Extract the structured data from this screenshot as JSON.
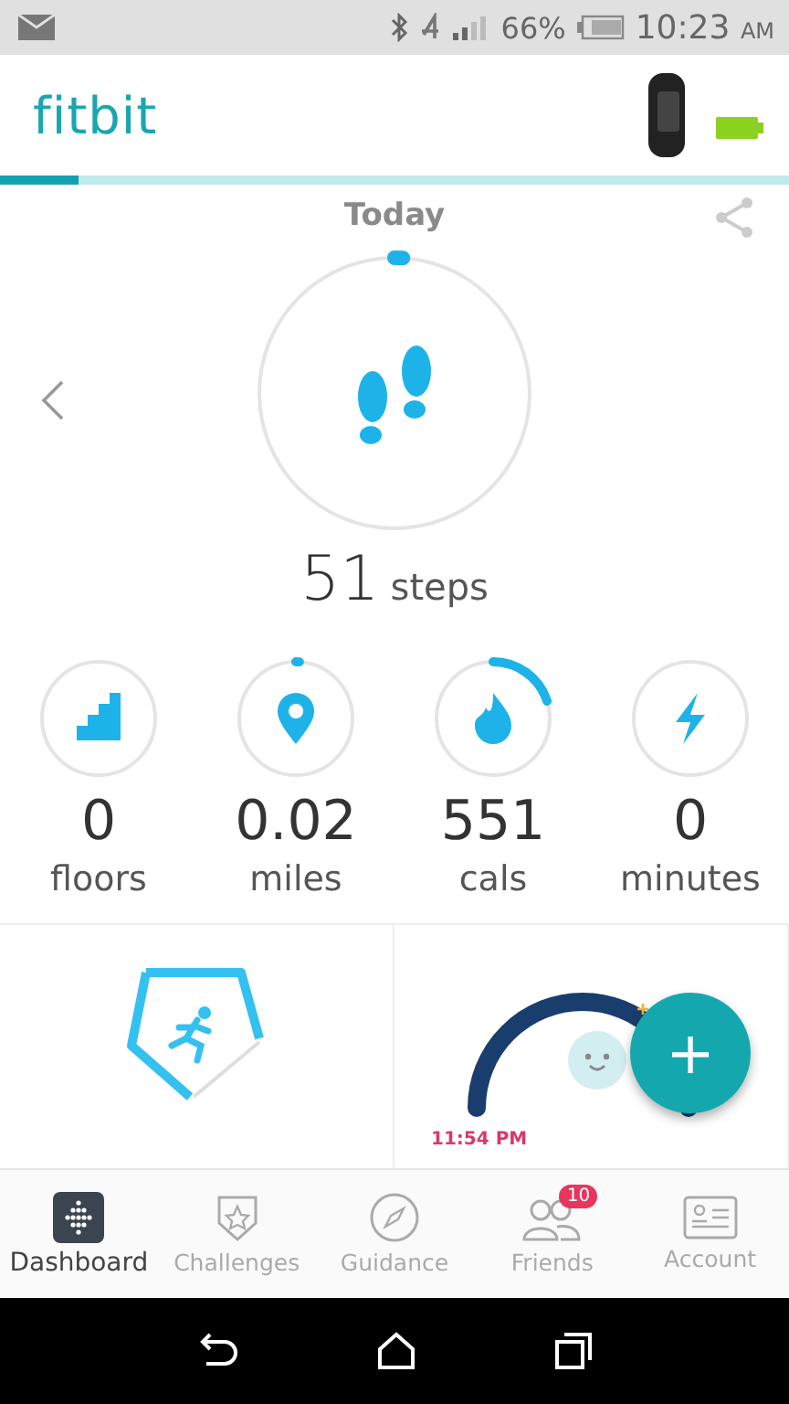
{
  "status_bar": {
    "battery": "66%",
    "time": "10:23",
    "ampm": "AM"
  },
  "header": {
    "logo": "fitbit",
    "level": 0.1
  },
  "day": {
    "title": "Today"
  },
  "steps": {
    "value": "51",
    "unit": "steps",
    "level": 0.01
  },
  "stats": [
    {
      "value": "0",
      "unit": "floors",
      "kind": "stairs"
    },
    {
      "value": "0.02",
      "unit": "miles",
      "level": 0.01,
      "kind": "pin"
    },
    {
      "value": "551",
      "unit": "cals",
      "level": 0.2,
      "kind": "flame"
    },
    {
      "value": "0",
      "unit": "minutes",
      "kind": "bolt"
    }
  ],
  "sleep": {
    "time": "11:54 PM"
  },
  "fab": {
    "label": "+"
  },
  "tabs": [
    {
      "label": "Dashboard",
      "selected": true,
      "kind": "dashboard"
    },
    {
      "label": "Challenges",
      "selected": false,
      "kind": "challenges"
    },
    {
      "label": "Guidance",
      "selected": false,
      "kind": "guidance"
    },
    {
      "label": "Friends",
      "selected": false,
      "kind": "friends",
      "badge": "10"
    },
    {
      "label": "Account",
      "selected": false,
      "kind": "account"
    }
  ]
}
